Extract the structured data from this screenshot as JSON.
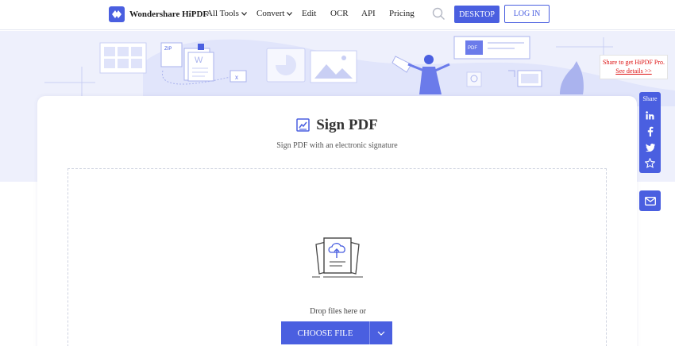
{
  "header": {
    "brand": "Wondershare HiPDF",
    "nav": [
      {
        "label": "All Tools",
        "has_caret": true
      },
      {
        "label": "Convert",
        "has_caret": true
      },
      {
        "label": "Edit",
        "has_caret": false
      },
      {
        "label": "OCR",
        "has_caret": false
      },
      {
        "label": "API",
        "has_caret": false
      },
      {
        "label": "Pricing",
        "has_caret": false
      }
    ],
    "desktop_label": "DESKTOP",
    "login_label": "LOG IN"
  },
  "banner": {
    "zip_label": "ZIP",
    "word_label": "W",
    "pdf_label": "PDF"
  },
  "promo": {
    "line1": "Share to get HiPDF Pro.",
    "link": "See details >>"
  },
  "share": {
    "label": "Share",
    "icons": [
      "linkedin-icon",
      "facebook-icon",
      "twitter-icon",
      "star-icon"
    ]
  },
  "main": {
    "title": "Sign PDF",
    "subtitle": "Sign PDF with an electronic signature",
    "drop_text": "Drop files here or",
    "choose_label": "CHOOSE FILE"
  },
  "colors": {
    "accent": "#4a5fe0",
    "banner_bg": "#eef0fc",
    "promo_red": "#dd1111"
  }
}
